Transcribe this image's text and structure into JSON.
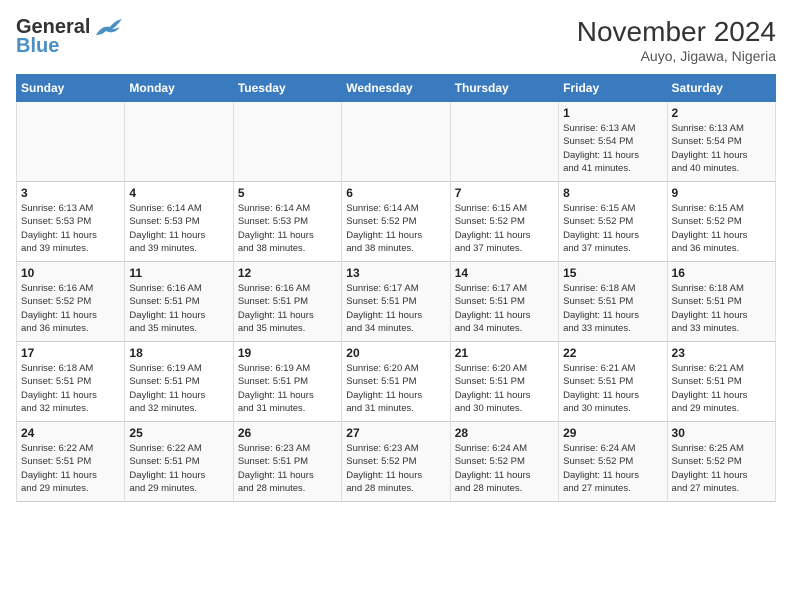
{
  "header": {
    "logo_line1": "General",
    "logo_line2": "Blue",
    "month_title": "November 2024",
    "location": "Auyo, Jigawa, Nigeria"
  },
  "weekdays": [
    "Sunday",
    "Monday",
    "Tuesday",
    "Wednesday",
    "Thursday",
    "Friday",
    "Saturday"
  ],
  "weeks": [
    [
      {
        "day": "",
        "info": ""
      },
      {
        "day": "",
        "info": ""
      },
      {
        "day": "",
        "info": ""
      },
      {
        "day": "",
        "info": ""
      },
      {
        "day": "",
        "info": ""
      },
      {
        "day": "1",
        "info": "Sunrise: 6:13 AM\nSunset: 5:54 PM\nDaylight: 11 hours\nand 41 minutes."
      },
      {
        "day": "2",
        "info": "Sunrise: 6:13 AM\nSunset: 5:54 PM\nDaylight: 11 hours\nand 40 minutes."
      }
    ],
    [
      {
        "day": "3",
        "info": "Sunrise: 6:13 AM\nSunset: 5:53 PM\nDaylight: 11 hours\nand 39 minutes."
      },
      {
        "day": "4",
        "info": "Sunrise: 6:14 AM\nSunset: 5:53 PM\nDaylight: 11 hours\nand 39 minutes."
      },
      {
        "day": "5",
        "info": "Sunrise: 6:14 AM\nSunset: 5:53 PM\nDaylight: 11 hours\nand 38 minutes."
      },
      {
        "day": "6",
        "info": "Sunrise: 6:14 AM\nSunset: 5:52 PM\nDaylight: 11 hours\nand 38 minutes."
      },
      {
        "day": "7",
        "info": "Sunrise: 6:15 AM\nSunset: 5:52 PM\nDaylight: 11 hours\nand 37 minutes."
      },
      {
        "day": "8",
        "info": "Sunrise: 6:15 AM\nSunset: 5:52 PM\nDaylight: 11 hours\nand 37 minutes."
      },
      {
        "day": "9",
        "info": "Sunrise: 6:15 AM\nSunset: 5:52 PM\nDaylight: 11 hours\nand 36 minutes."
      }
    ],
    [
      {
        "day": "10",
        "info": "Sunrise: 6:16 AM\nSunset: 5:52 PM\nDaylight: 11 hours\nand 36 minutes."
      },
      {
        "day": "11",
        "info": "Sunrise: 6:16 AM\nSunset: 5:51 PM\nDaylight: 11 hours\nand 35 minutes."
      },
      {
        "day": "12",
        "info": "Sunrise: 6:16 AM\nSunset: 5:51 PM\nDaylight: 11 hours\nand 35 minutes."
      },
      {
        "day": "13",
        "info": "Sunrise: 6:17 AM\nSunset: 5:51 PM\nDaylight: 11 hours\nand 34 minutes."
      },
      {
        "day": "14",
        "info": "Sunrise: 6:17 AM\nSunset: 5:51 PM\nDaylight: 11 hours\nand 34 minutes."
      },
      {
        "day": "15",
        "info": "Sunrise: 6:18 AM\nSunset: 5:51 PM\nDaylight: 11 hours\nand 33 minutes."
      },
      {
        "day": "16",
        "info": "Sunrise: 6:18 AM\nSunset: 5:51 PM\nDaylight: 11 hours\nand 33 minutes."
      }
    ],
    [
      {
        "day": "17",
        "info": "Sunrise: 6:18 AM\nSunset: 5:51 PM\nDaylight: 11 hours\nand 32 minutes."
      },
      {
        "day": "18",
        "info": "Sunrise: 6:19 AM\nSunset: 5:51 PM\nDaylight: 11 hours\nand 32 minutes."
      },
      {
        "day": "19",
        "info": "Sunrise: 6:19 AM\nSunset: 5:51 PM\nDaylight: 11 hours\nand 31 minutes."
      },
      {
        "day": "20",
        "info": "Sunrise: 6:20 AM\nSunset: 5:51 PM\nDaylight: 11 hours\nand 31 minutes."
      },
      {
        "day": "21",
        "info": "Sunrise: 6:20 AM\nSunset: 5:51 PM\nDaylight: 11 hours\nand 30 minutes."
      },
      {
        "day": "22",
        "info": "Sunrise: 6:21 AM\nSunset: 5:51 PM\nDaylight: 11 hours\nand 30 minutes."
      },
      {
        "day": "23",
        "info": "Sunrise: 6:21 AM\nSunset: 5:51 PM\nDaylight: 11 hours\nand 29 minutes."
      }
    ],
    [
      {
        "day": "24",
        "info": "Sunrise: 6:22 AM\nSunset: 5:51 PM\nDaylight: 11 hours\nand 29 minutes."
      },
      {
        "day": "25",
        "info": "Sunrise: 6:22 AM\nSunset: 5:51 PM\nDaylight: 11 hours\nand 29 minutes."
      },
      {
        "day": "26",
        "info": "Sunrise: 6:23 AM\nSunset: 5:51 PM\nDaylight: 11 hours\nand 28 minutes."
      },
      {
        "day": "27",
        "info": "Sunrise: 6:23 AM\nSunset: 5:52 PM\nDaylight: 11 hours\nand 28 minutes."
      },
      {
        "day": "28",
        "info": "Sunrise: 6:24 AM\nSunset: 5:52 PM\nDaylight: 11 hours\nand 28 minutes."
      },
      {
        "day": "29",
        "info": "Sunrise: 6:24 AM\nSunset: 5:52 PM\nDaylight: 11 hours\nand 27 minutes."
      },
      {
        "day": "30",
        "info": "Sunrise: 6:25 AM\nSunset: 5:52 PM\nDaylight: 11 hours\nand 27 minutes."
      }
    ]
  ]
}
